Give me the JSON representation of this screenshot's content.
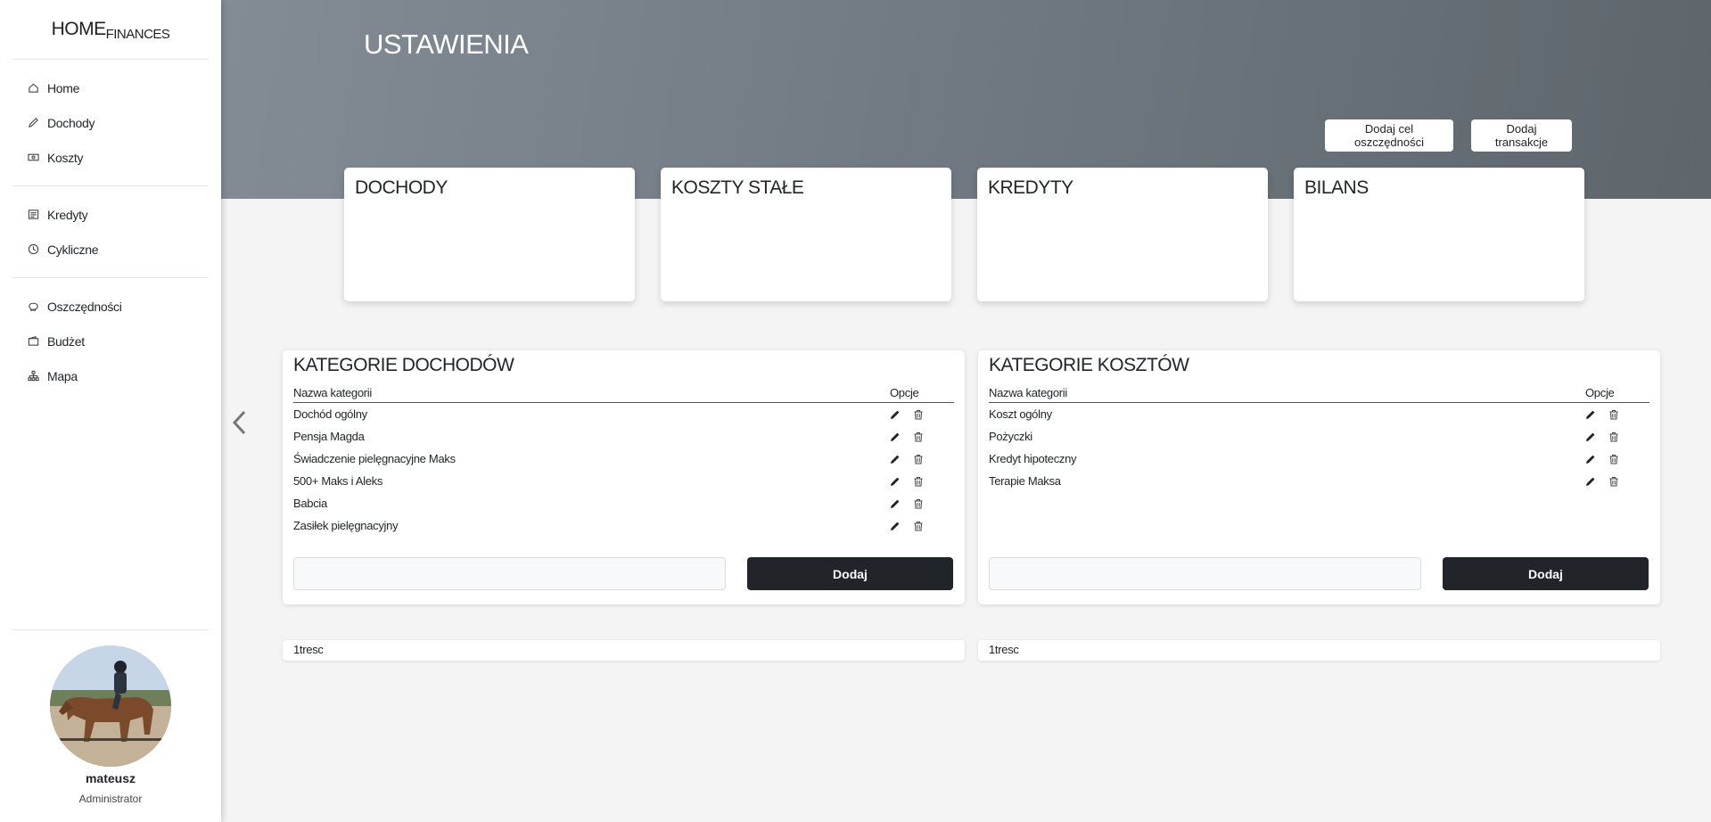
{
  "brand": {
    "main": "HOME",
    "sub": "FINANCES"
  },
  "sidebar": {
    "groups": [
      {
        "items": [
          {
            "label": "Home",
            "icon": "home-icon"
          },
          {
            "label": "Dochody",
            "icon": "pencil-icon"
          },
          {
            "label": "Koszty",
            "icon": "cash-icon"
          }
        ]
      },
      {
        "items": [
          {
            "label": "Kredyty",
            "icon": "newspaper-icon"
          },
          {
            "label": "Cykliczne",
            "icon": "clock-icon"
          }
        ]
      },
      {
        "items": [
          {
            "label": "Oszczędności",
            "icon": "piggy-bank-icon"
          },
          {
            "label": "Budżet",
            "icon": "wallet-icon"
          },
          {
            "label": "Mapa",
            "icon": "diagram-icon"
          }
        ]
      }
    ]
  },
  "profile": {
    "name": "mateusz",
    "role": "Administrator"
  },
  "header": {
    "title": "USTAWIENIA",
    "btn_goal": "Dodaj cel oszczędności",
    "btn_transaction": "Dodaj transakcje"
  },
  "summary_cards": [
    "DOCHODY",
    "KOSZTY STAŁE",
    "KREDYTY",
    "BILANS"
  ],
  "income_panel": {
    "title": "KATEGORIE DOCHODÓW",
    "col_name": "Nazwa kategorii",
    "col_options": "Opcje",
    "rows": [
      "Dochód ogólny",
      "Pensja Magda",
      "Świadczenie pielęgnacyjne Maks",
      "500+ Maks i Aleks",
      "Babcia",
      "Zasiłek pielęgnacyjny"
    ],
    "input_placeholder": "",
    "add_label": "Dodaj",
    "footer": "1tresc"
  },
  "cost_panel": {
    "title": "KATEGORIE KOSZTÓW",
    "col_name": "Nazwa kategorii",
    "col_options": "Opcje",
    "rows": [
      "Koszt ogólny",
      "Pożyczki",
      "Kredyt hipoteczny",
      "Terapie Maksa"
    ],
    "input_placeholder": "",
    "add_label": "Dodaj",
    "footer": "1tresc"
  },
  "colors": {
    "header_start": "#838c95",
    "header_end": "#5e666c",
    "button_dark": "#212529",
    "page_bg": "#f4f4f4"
  }
}
